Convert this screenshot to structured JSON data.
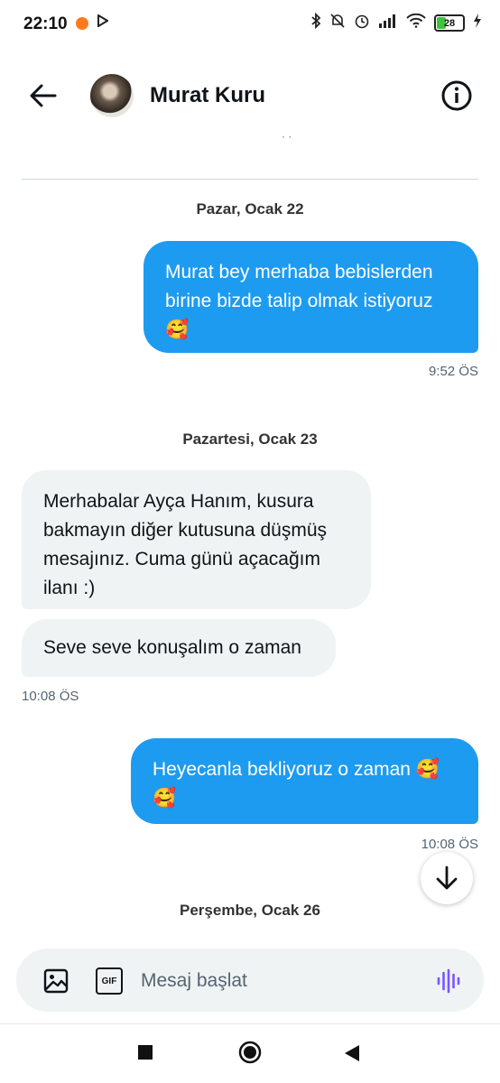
{
  "status_bar": {
    "time": "22:10",
    "battery_level": "28",
    "icons": [
      "notification-dot-icon",
      "play-store-icon",
      "bluetooth-icon",
      "dnd-icon",
      "alarm-icon",
      "signal-icon",
      "wifi-icon",
      "battery-icon",
      "charging-icon"
    ]
  },
  "header": {
    "contact_name": "Murat Kuru",
    "back_icon": "arrow-left-icon",
    "info_icon": "info-icon"
  },
  "conversation": {
    "dates": [
      "Pazar, Ocak 22",
      "Pazartesi, Ocak 23",
      "Perşembe, Ocak 26"
    ],
    "messages": [
      {
        "direction": "out",
        "lines": [
          "Murat bey merhaba bebislerden",
          "birine bizde talip olmak istiyoruz",
          "🥰"
        ],
        "time": "9:52 ÖS"
      },
      {
        "direction": "in",
        "lines": [
          "Merhabalar Ayça Hanım, kusura",
          "bakmayın diğer kutusuna düşmüş",
          "mesajınız. Cuma günü açacağım",
          "ilanı :)"
        ]
      },
      {
        "direction": "in",
        "lines": [
          "Seve seve konuşalım o zaman"
        ],
        "time": "10:08 ÖS"
      },
      {
        "direction": "out",
        "lines": [
          "Heyecanla bekliyoruz o zaman 🥰",
          "🥰"
        ],
        "time": "10:08 ÖS"
      }
    ]
  },
  "composer": {
    "placeholder": "Mesaj başlat",
    "gif_label": "GIF"
  },
  "colors": {
    "accent": "#1d9bf0",
    "incoming_bubble": "#eff3f4",
    "voice_icon": "#7856ff"
  }
}
